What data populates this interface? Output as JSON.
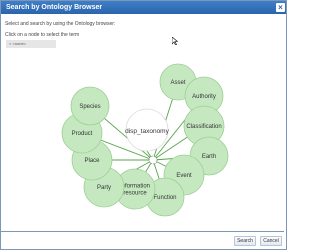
{
  "dialog": {
    "title": "Search by Ontology Browser",
    "close_icon": "close-icon",
    "accent_color": "#2a64ad"
  },
  "instructions": {
    "line1": "Select and search by using the Ontology browser:",
    "line2": "Click on a node to select the term",
    "breadcrumb": "> <none>"
  },
  "graph": {
    "root": {
      "label": "disp_taxonomy"
    },
    "node_color": "#c5e8c0",
    "node_border": "#9ccf94",
    "edge_color": "#57a64a",
    "nodes": [
      {
        "label": "Asset"
      },
      {
        "label": "Authority"
      },
      {
        "label": "Classification"
      },
      {
        "label": "Earth"
      },
      {
        "label": "Event"
      },
      {
        "label": "Function"
      },
      {
        "label": "Information resource"
      },
      {
        "label": "Party"
      },
      {
        "label": "Place"
      },
      {
        "label": "Product"
      },
      {
        "label": "Species"
      }
    ]
  },
  "footer": {
    "search_label": "Search",
    "cancel_label": "Cancel"
  }
}
